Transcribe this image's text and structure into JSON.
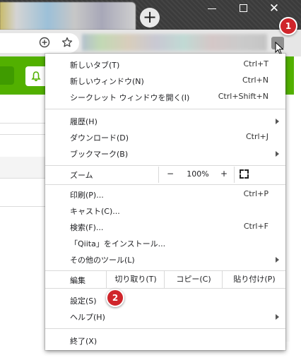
{
  "tabstrip": {
    "new_tab_icon": "plus-icon",
    "window_controls": {
      "minimize": "minimize-icon",
      "maximize": "maximize-icon",
      "close_glyph": "✕"
    }
  },
  "toolbar": {
    "zoom_icon": "add-circle-icon",
    "bookmark_icon": "star-icon",
    "menu_icon": "more-vertical-icon"
  },
  "page": {
    "accent_color": "#52b000",
    "notification_icon": "bell-icon"
  },
  "menu": {
    "items": [
      {
        "label": "新しいタブ(T)",
        "shortcut": "Ctrl+T"
      },
      {
        "label": "新しいウィンドウ(N)",
        "shortcut": "Ctrl+N"
      },
      {
        "label": "シークレット ウィンドウを開く(I)",
        "shortcut": "Ctrl+Shift+N"
      },
      {
        "label": "履歴(H)",
        "shortcut": ""
      },
      {
        "label": "ダウンロード(D)",
        "shortcut": "Ctrl+J"
      },
      {
        "label": "ブックマーク(B)",
        "shortcut": ""
      },
      {
        "label": "印刷(P)...",
        "shortcut": "Ctrl+P"
      },
      {
        "label": "キャスト(C)...",
        "shortcut": ""
      },
      {
        "label": "検索(F)...",
        "shortcut": "Ctrl+F"
      },
      {
        "label": "「Qiita」をインストール...",
        "shortcut": ""
      },
      {
        "label": "その他のツール(L)",
        "shortcut": ""
      },
      {
        "label": "設定(S)",
        "shortcut": ""
      },
      {
        "label": "ヘルプ(H)",
        "shortcut": ""
      },
      {
        "label": "終了(X)",
        "shortcut": ""
      }
    ],
    "zoom": {
      "label": "ズーム",
      "minus": "−",
      "value": "100%",
      "plus": "+"
    },
    "edit": {
      "label": "編集",
      "cut": "切り取り(T)",
      "copy": "コピー(C)",
      "paste": "貼り付け(P)"
    }
  },
  "annotations": {
    "step1": "1",
    "step2": "2",
    "color": "#d0252b"
  }
}
